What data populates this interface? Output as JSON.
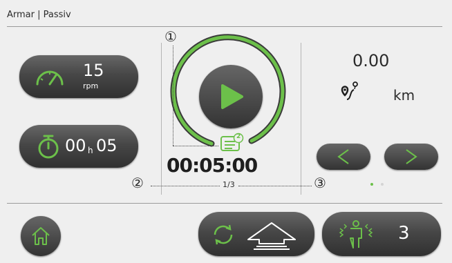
{
  "header": {
    "title": "Armar | Passiv"
  },
  "speed": {
    "value": "15",
    "unit": "rpm",
    "icon": "speedometer-icon"
  },
  "duration": {
    "hours": "00",
    "hours_unit": "h",
    "minutes": "05",
    "icon": "stopwatch-icon"
  },
  "center": {
    "play_icon": "play-icon",
    "program_icon": "program-list-icon",
    "program_badge": "2",
    "timer": "00:05:00",
    "page_indicator": "1/3"
  },
  "distance": {
    "value": "0.00",
    "unit": "km",
    "icon": "route-icon"
  },
  "nav": {
    "prev_icon": "chevron-left-icon",
    "next_icon": "chevron-right-icon",
    "page_count": 2,
    "active_page": 1
  },
  "callouts": {
    "c1": "①",
    "c2": "②",
    "c3": "③"
  },
  "bottom": {
    "home_icon": "home-icon",
    "rotation_icon": "rotation-icon",
    "direction_icon": "forward-arrow-icon",
    "spasm_icon": "spasm-person-icon",
    "spasm_level": "3"
  },
  "colors": {
    "accent": "#6cc04a",
    "pill_dark": "#3a3a3a",
    "background": "#efefef"
  }
}
